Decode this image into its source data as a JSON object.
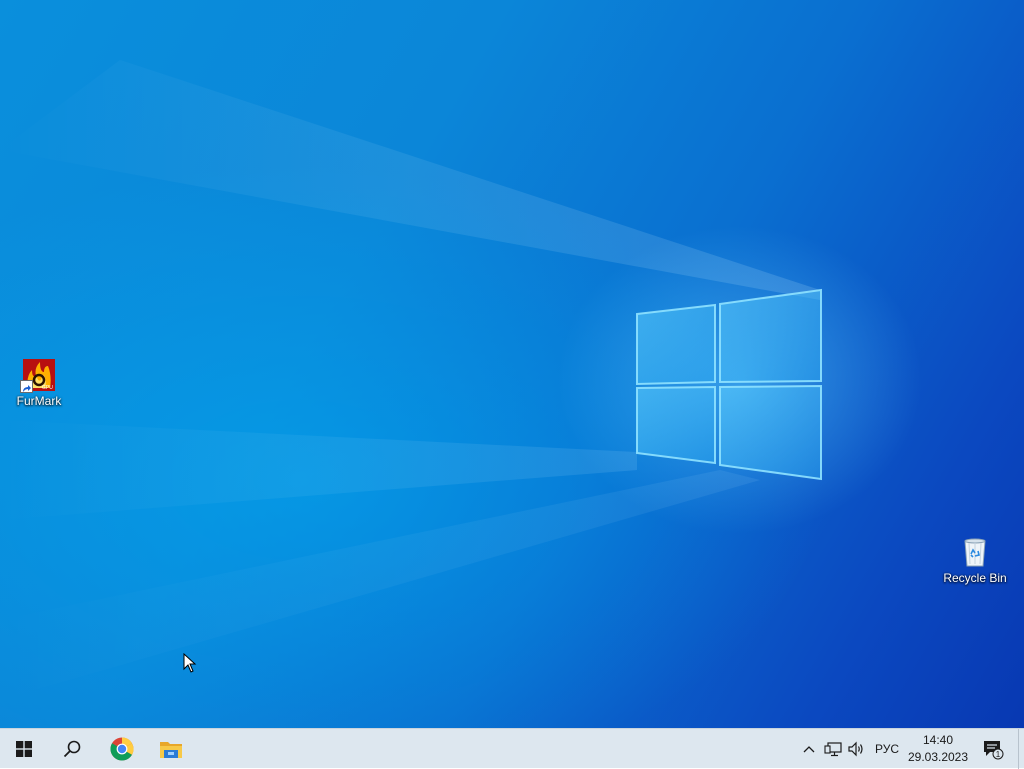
{
  "desktop": {
    "icons": [
      {
        "label": "FurMark"
      },
      {
        "label": "Recycle Bin"
      }
    ]
  },
  "taskbar": {
    "start_icon": "windows-logo-icon",
    "search_icon": "search-icon",
    "pinned": [
      "chrome-icon",
      "file-explorer-icon"
    ],
    "tray": {
      "language": "РУС",
      "time": "14:40",
      "date": "29.03.2023",
      "notification_count": "1"
    }
  },
  "colors": {
    "taskbar_bg": "#dde7ef",
    "wallpaper_primary": "#0a86d8",
    "wallpaper_dark": "#0838b2",
    "logo_glow": "#6fd4ff"
  }
}
